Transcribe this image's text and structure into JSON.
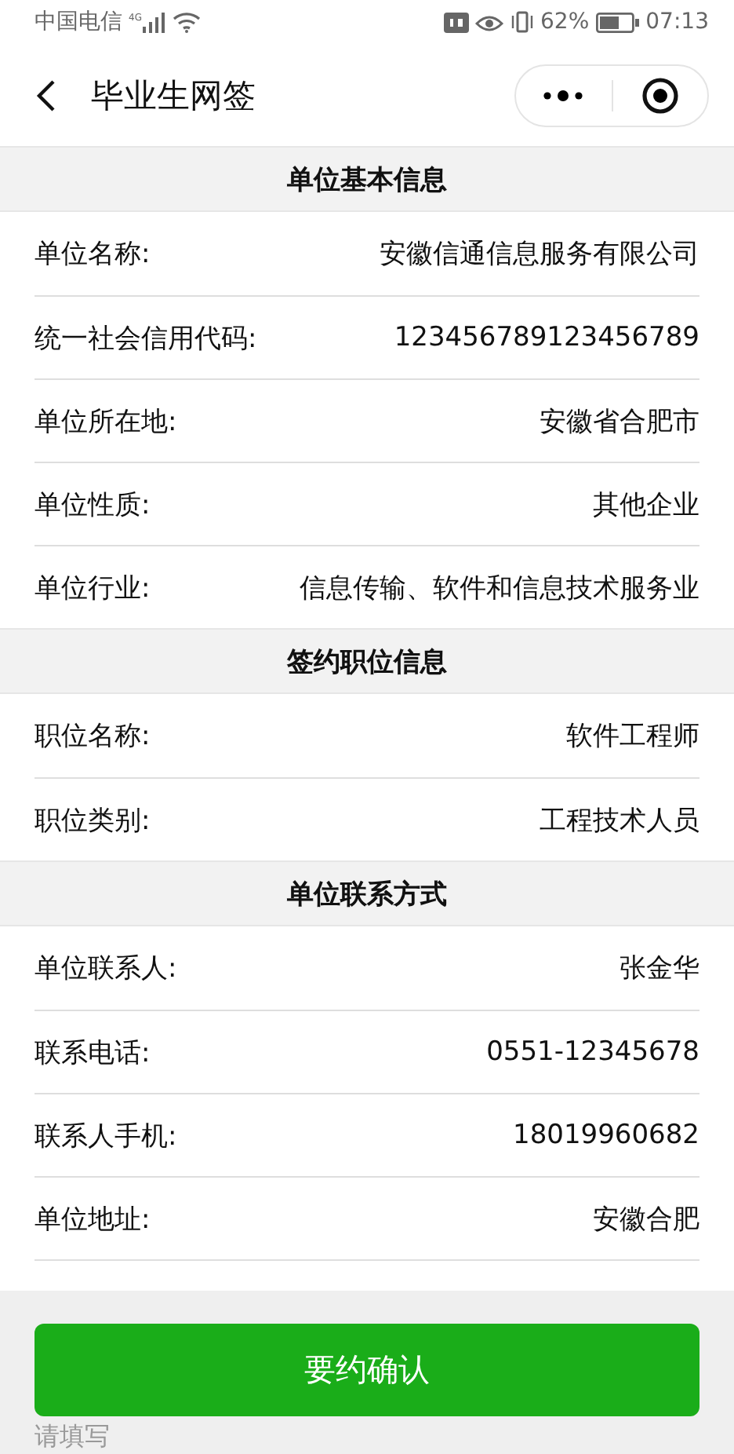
{
  "status_bar": {
    "carrier": "中国电信",
    "network": "4G",
    "battery": "62%",
    "time": "07:13"
  },
  "nav": {
    "title": "毕业生网签"
  },
  "sections": [
    {
      "title": "单位基本信息",
      "rows": [
        {
          "label": "单位名称:",
          "value": "安徽信通信息服务有限公司"
        },
        {
          "label": "统一社会信用代码:",
          "value": "123456789123456789"
        },
        {
          "label": "单位所在地:",
          "value": "安徽省合肥市"
        },
        {
          "label": "单位性质:",
          "value": "其他企业"
        },
        {
          "label": "单位行业:",
          "value": "信息传输、软件和信息技术服务业"
        }
      ]
    },
    {
      "title": "签约职位信息",
      "rows": [
        {
          "label": "职位名称:",
          "value": "软件工程师"
        },
        {
          "label": "职位类别:",
          "value": "工程技术人员"
        }
      ]
    },
    {
      "title": "单位联系方式",
      "rows": [
        {
          "label": "单位联系人:",
          "value": "张金华"
        },
        {
          "label": "联系电话:",
          "value": "0551-12345678"
        },
        {
          "label": "联系人手机:",
          "value": "18019960682"
        },
        {
          "label": "单位地址:",
          "value": "安徽合肥"
        }
      ]
    }
  ],
  "footer": {
    "button": "要约确认",
    "placeholder": "请填写"
  }
}
